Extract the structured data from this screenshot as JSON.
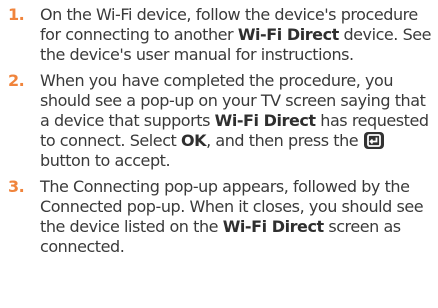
{
  "steps": [
    {
      "number": "1.",
      "parts": [
        {
          "text": "On the Wi-Fi device, follow the device's procedure for connecting to another ",
          "bold": false
        },
        {
          "text": "Wi-Fi Direct",
          "bold": true
        },
        {
          "text": " device. See the device's user manual for instructions.",
          "bold": false
        }
      ]
    },
    {
      "number": "2.",
      "parts": [
        {
          "text": "When you have completed the procedure, you should see a pop-up on your TV screen saying that a device that supports ",
          "bold": false
        },
        {
          "text": "Wi-Fi Direct",
          "bold": true
        },
        {
          "text": " has requested to connect. Select ",
          "bold": false
        },
        {
          "text": "OK",
          "bold": true
        },
        {
          "text": ", and then press the ",
          "bold": false
        },
        {
          "icon": "enter-button-icon"
        },
        {
          "text": " button to accept.",
          "bold": false
        }
      ]
    },
    {
      "number": "3.",
      "parts": [
        {
          "text": "The Connecting pop-up appears, followed by the Connected pop-up. When it closes, you should see the device listed on the ",
          "bold": false
        },
        {
          "text": "Wi-Fi Direct",
          "bold": true
        },
        {
          "text": " screen as connected.",
          "bold": false
        }
      ]
    }
  ],
  "colors": {
    "step_number": "#f0843c",
    "body_text": "#3a3a3a",
    "icon_background": "#333333"
  }
}
